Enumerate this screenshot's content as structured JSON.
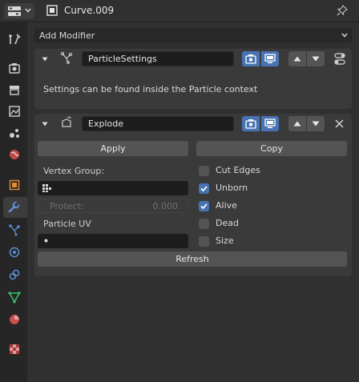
{
  "header": {
    "object_name": "Curve.009"
  },
  "modifier_panel": {
    "add_modifier_label": "Add Modifier"
  },
  "particle_settings": {
    "name": "ParticleSettings",
    "message": "Settings can be found inside the Particle context"
  },
  "explode": {
    "name": "Explode",
    "apply_label": "Apply",
    "copy_label": "Copy",
    "vertex_group_label": "Vertex Group:",
    "vertex_group_value": "",
    "protect_label": "Protect:",
    "protect_value": "0.000",
    "particle_uv_label": "Particle UV",
    "particle_uv_value": "",
    "refresh_label": "Refresh",
    "options": [
      {
        "label": "Cut Edges",
        "checked": false
      },
      {
        "label": "Unborn",
        "checked": true
      },
      {
        "label": "Alive",
        "checked": true
      },
      {
        "label": "Dead",
        "checked": false
      },
      {
        "label": "Size",
        "checked": false
      }
    ]
  },
  "colors": {
    "accent": "#4772b3",
    "panel": "#3a3a3a",
    "background": "#303030"
  }
}
